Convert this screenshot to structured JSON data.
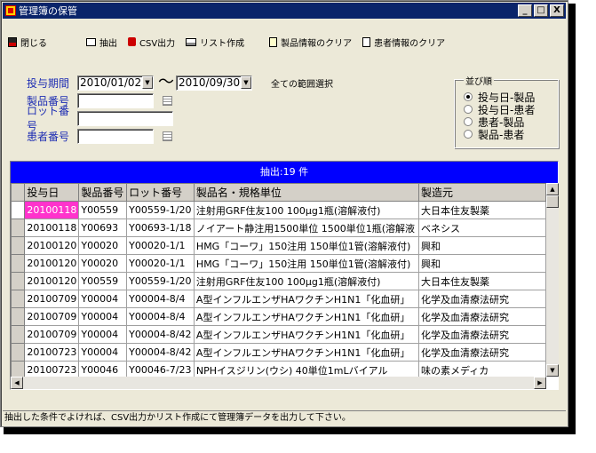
{
  "window": {
    "title": "管理簿の保管"
  },
  "title_buttons": {
    "minimize": "_",
    "maximize": "□",
    "close": "X"
  },
  "toolbar": {
    "close": "閉じる",
    "extract": "抽出",
    "csv": "CSV出力",
    "list": "リスト作成",
    "clear_product": "製品情報のクリア",
    "clear_patient": "患者情報のクリア"
  },
  "form": {
    "period_label": "投与期間",
    "date_from": "2010/01/02",
    "tilde": "〜",
    "date_to": "2010/09/30",
    "all_range": "全ての範囲選択",
    "product_label": "製品番号",
    "product_value": "",
    "lot_label": "ロット番号",
    "lot_value": "",
    "patient_label": "患者番号",
    "patient_value": ""
  },
  "sort": {
    "legend": "並び順",
    "options": [
      "投与日-製品",
      "投与日-患者",
      "患者-製品",
      "製品-患者"
    ],
    "selected": 0
  },
  "grid": {
    "header": "抽出:19 件",
    "columns": [
      "投与日",
      "製品番号",
      "ロット番号",
      "製品名・規格単位",
      "製造元"
    ],
    "rows": [
      [
        "20100118",
        "Y00559",
        "Y00559-1/20",
        "注射用GRF住友100 100μg1瓶(溶解液付)",
        "大日本住友製薬"
      ],
      [
        "20100118",
        "Y00693",
        "Y00693-1/18",
        "ノイアート静注用1500単位 1500単位1瓶(溶解液",
        "ベネシス"
      ],
      [
        "20100120",
        "Y00020",
        "Y00020-1/1",
        "HMG「コーワ」150注用 150単位1管(溶解液付)",
        "興和"
      ],
      [
        "20100120",
        "Y00020",
        "Y00020-1/1",
        "HMG「コーワ」150注用 150単位1管(溶解液付)",
        "興和"
      ],
      [
        "20100120",
        "Y00559",
        "Y00559-1/20",
        "注射用GRF住友100 100μg1瓶(溶解液付)",
        "大日本住友製薬"
      ],
      [
        "20100709",
        "Y00004",
        "Y00004-8/4",
        "A型インフルエンザHAワクチンH1N1「化血研」",
        "化学及血清療法研究"
      ],
      [
        "20100709",
        "Y00004",
        "Y00004-8/4",
        "A型インフルエンザHAワクチンH1N1「化血研」",
        "化学及血清療法研究"
      ],
      [
        "20100709",
        "Y00004",
        "Y00004-8/42",
        "A型インフルエンザHAワクチンH1N1「化血研」",
        "化学及血清療法研究"
      ],
      [
        "20100723",
        "Y00004",
        "Y00004-8/42",
        "A型インフルエンザHAワクチンH1N1「化血研」",
        "化学及血清療法研究"
      ],
      [
        "20100723",
        "Y00046",
        "Y00046-7/23",
        "NPHイスジリン(ウシ) 40単位1mLバイアル",
        "味の素メディカ"
      ]
    ],
    "highlight_color": "#ff33cc",
    "header_color": "#0000ff"
  },
  "scroll": {
    "up": "▲",
    "down": "▼",
    "left": "◀",
    "right": "▶"
  },
  "status": "抽出した条件でよければ、CSV出力かリスト作成にて管理簿データを出力して下さい。"
}
